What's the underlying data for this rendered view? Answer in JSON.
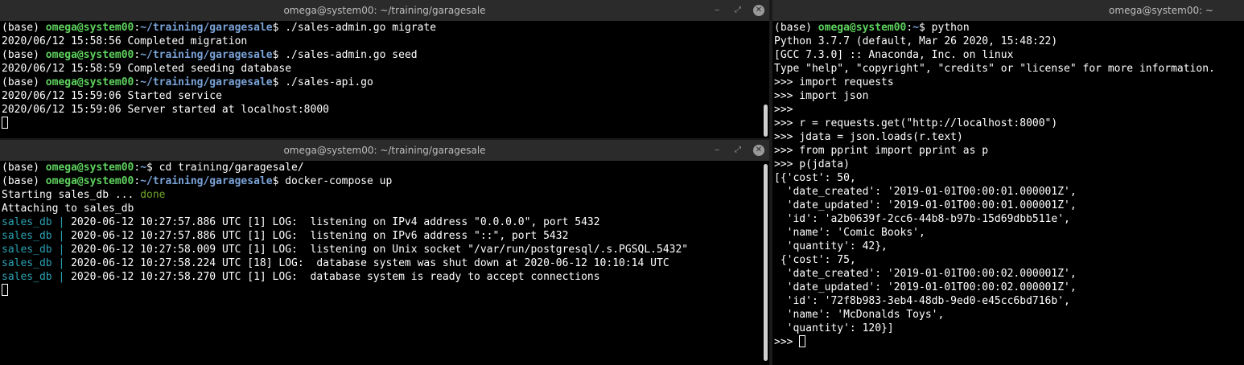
{
  "window_top_left": {
    "title": "omega@system00: ~/training/garagesale",
    "lines": [
      [
        {
          "t": "(base) ",
          "c": ""
        },
        {
          "t": "omega@system00",
          "c": "g"
        },
        {
          "t": ":",
          "c": ""
        },
        {
          "t": "~/training/garagesale",
          "c": "b"
        },
        {
          "t": "$ ./sales-admin.go migrate",
          "c": ""
        }
      ],
      [
        {
          "t": "2020/06/12 15:58:56 Completed migration",
          "c": ""
        }
      ],
      [
        {
          "t": "(base) ",
          "c": ""
        },
        {
          "t": "omega@system00",
          "c": "g"
        },
        {
          "t": ":",
          "c": ""
        },
        {
          "t": "~/training/garagesale",
          "c": "b"
        },
        {
          "t": "$ ./sales-admin.go seed",
          "c": ""
        }
      ],
      [
        {
          "t": "2020/06/12 15:58:59 Completed seeding database",
          "c": ""
        }
      ],
      [
        {
          "t": "(base) ",
          "c": ""
        },
        {
          "t": "omega@system00",
          "c": "g"
        },
        {
          "t": ":",
          "c": ""
        },
        {
          "t": "~/training/garagesale",
          "c": "b"
        },
        {
          "t": "$ ./sales-api.go",
          "c": ""
        }
      ],
      [
        {
          "t": "2020/06/12 15:59:06 Started service",
          "c": ""
        }
      ],
      [
        {
          "t": "2020/06/12 15:59:06 Server started at localhost:8000",
          "c": ""
        }
      ]
    ]
  },
  "window_bottom_left": {
    "title": "omega@system00: ~/training/garagesale",
    "lines": [
      [
        {
          "t": "(base) ",
          "c": ""
        },
        {
          "t": "omega@system00",
          "c": "g"
        },
        {
          "t": ":",
          "c": ""
        },
        {
          "t": "~",
          "c": "b"
        },
        {
          "t": "$ cd training/garagesale/",
          "c": ""
        }
      ],
      [
        {
          "t": "(base) ",
          "c": ""
        },
        {
          "t": "omega@system00",
          "c": "g"
        },
        {
          "t": ":",
          "c": ""
        },
        {
          "t": "~/training/garagesale",
          "c": "b"
        },
        {
          "t": "$ docker-compose up",
          "c": ""
        }
      ],
      [
        {
          "t": "Starting sales_db ... ",
          "c": ""
        },
        {
          "t": "done",
          "c": "dn"
        }
      ],
      [
        {
          "t": "Attaching to sales_db",
          "c": ""
        }
      ],
      [
        {
          "t": "sales_db |",
          "c": "cy"
        },
        {
          "t": " 2020-06-12 10:27:57.886 UTC [1] LOG:  listening on IPv4 address \"0.0.0.0\", port 5432",
          "c": ""
        }
      ],
      [
        {
          "t": "sales_db |",
          "c": "cy"
        },
        {
          "t": " 2020-06-12 10:27:57.886 UTC [1] LOG:  listening on IPv6 address \"::\", port 5432",
          "c": ""
        }
      ],
      [
        {
          "t": "sales_db |",
          "c": "cy"
        },
        {
          "t": " 2020-06-12 10:27:58.009 UTC [1] LOG:  listening on Unix socket \"/var/run/postgresql/.s.PGSQL.5432\"",
          "c": ""
        }
      ],
      [
        {
          "t": "sales_db |",
          "c": "cy"
        },
        {
          "t": " 2020-06-12 10:27:58.224 UTC [18] LOG:  database system was shut down at 2020-06-12 10:10:14 UTC",
          "c": ""
        }
      ],
      [
        {
          "t": "sales_db |",
          "c": "cy"
        },
        {
          "t": " 2020-06-12 10:27:58.270 UTC [1] LOG:  database system is ready to accept connections",
          "c": ""
        }
      ]
    ]
  },
  "window_right": {
    "title": "omega@system00: ~",
    "lines": [
      [
        {
          "t": "(base) ",
          "c": ""
        },
        {
          "t": "omega@system00",
          "c": "g"
        },
        {
          "t": ":",
          "c": ""
        },
        {
          "t": "~",
          "c": "b"
        },
        {
          "t": "$ python",
          "c": ""
        }
      ],
      [
        {
          "t": "Python 3.7.7 (default, Mar 26 2020, 15:48:22)",
          "c": ""
        }
      ],
      [
        {
          "t": "[GCC 7.3.0] :: Anaconda, Inc. on linux",
          "c": ""
        }
      ],
      [
        {
          "t": "Type \"help\", \"copyright\", \"credits\" or \"license\" for more information.",
          "c": ""
        }
      ],
      [
        {
          "t": ">>> import requests",
          "c": ""
        }
      ],
      [
        {
          "t": ">>> import json",
          "c": ""
        }
      ],
      [
        {
          "t": ">>>",
          "c": ""
        }
      ],
      [
        {
          "t": ">>> r = requests.get(\"http://localhost:8000\")",
          "c": ""
        }
      ],
      [
        {
          "t": ">>> jdata = json.loads(r.text)",
          "c": ""
        }
      ],
      [
        {
          "t": ">>> from pprint import pprint as p",
          "c": ""
        }
      ],
      [
        {
          "t": ">>> p(jdata)",
          "c": ""
        }
      ],
      [
        {
          "t": "[{'cost': 50,",
          "c": ""
        }
      ],
      [
        {
          "t": "  'date_created': '2019-01-01T00:00:01.000001Z',",
          "c": ""
        }
      ],
      [
        {
          "t": "  'date_updated': '2019-01-01T00:00:01.000001Z',",
          "c": ""
        }
      ],
      [
        {
          "t": "  'id': 'a2b0639f-2cc6-44b8-b97b-15d69dbb511e',",
          "c": ""
        }
      ],
      [
        {
          "t": "  'name': 'Comic Books',",
          "c": ""
        }
      ],
      [
        {
          "t": "  'quantity': 42},",
          "c": ""
        }
      ],
      [
        {
          "t": " {'cost': 75,",
          "c": ""
        }
      ],
      [
        {
          "t": "  'date_created': '2019-01-01T00:00:02.000001Z',",
          "c": ""
        }
      ],
      [
        {
          "t": "  'date_updated': '2019-01-01T00:00:02.000001Z',",
          "c": ""
        }
      ],
      [
        {
          "t": "  'id': '72f8b983-3eb4-48db-9ed0-e45cc6bd716b',",
          "c": ""
        }
      ],
      [
        {
          "t": "  'name': 'McDonalds Toys',",
          "c": ""
        }
      ],
      [
        {
          "t": "  'quantity': 120}]",
          "c": ""
        }
      ]
    ],
    "prompt_last": ">>> "
  },
  "icons": {
    "minimize": "minimize-icon",
    "maximize": "maximize-icon",
    "close": "close-icon"
  },
  "colors": {
    "user_host": "#5ed35e",
    "path": "#7aa3d8",
    "done": "#6fa62a",
    "sales_db": "#2aa1b3",
    "background": "#000000",
    "titlebar": "#2b2b2b"
  }
}
